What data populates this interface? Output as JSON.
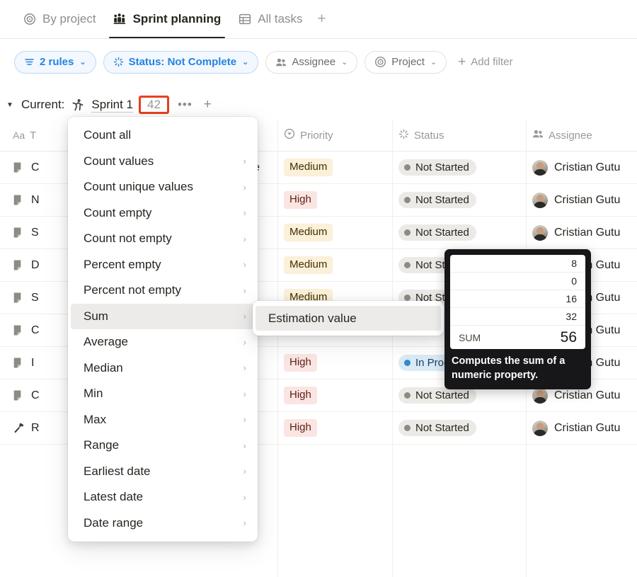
{
  "tabs": [
    {
      "label": "By project",
      "icon": "target-icon",
      "active": false
    },
    {
      "label": "Sprint planning",
      "icon": "people-board-icon",
      "active": true
    },
    {
      "label": "All tasks",
      "icon": "table-icon",
      "active": false
    }
  ],
  "tab_add_label": "+",
  "filters": {
    "rules": {
      "label": "2 rules",
      "icon": "rules-icon",
      "chevron": "⌄"
    },
    "status": {
      "label": "Status: Not Complete",
      "icon": "status-spinner-icon",
      "chevron": "⌄"
    },
    "assignee": {
      "label": "Assignee",
      "icon": "people-icon",
      "chevron": "⌄"
    },
    "project": {
      "label": "Project",
      "icon": "target-icon",
      "chevron": "⌄"
    },
    "add_filter": {
      "label": "Add filter",
      "plus": "+"
    }
  },
  "group": {
    "caret": "▼",
    "label": "Current:",
    "sprint_icon": "runner-icon",
    "sprint_name": "Sprint 1",
    "count": "42",
    "dots": "•••",
    "plus": "+"
  },
  "table": {
    "headers": [
      {
        "label": "T",
        "icon": "title-aa-icon"
      },
      {
        "label": "Priority",
        "icon": "priority-icon"
      },
      {
        "label": "Status",
        "icon": "status-spinner-icon"
      },
      {
        "label": "Assignee",
        "icon": "people-icon"
      }
    ],
    "rows": [
      {
        "icon": "document-icon",
        "title": "C",
        "title_tail": "e",
        "priority": "Medium",
        "status": "Not Started",
        "assignee": "Cristian Gutu"
      },
      {
        "icon": "document-icon",
        "title": "N",
        "title_tail": "",
        "priority": "High",
        "status": "Not Started",
        "assignee": "Cristian Gutu"
      },
      {
        "icon": "document-icon",
        "title": "S",
        "title_tail": "",
        "priority": "Medium",
        "status": "Not Started",
        "assignee": "Cristian Gutu"
      },
      {
        "icon": "document-icon",
        "title": "D",
        "title_tail": "",
        "priority": "Medium",
        "status": "Not Started",
        "assignee": "Cristian Gutu"
      },
      {
        "icon": "document-icon",
        "title": "S",
        "title_tail": "",
        "priority": "Medium",
        "status": "Not Started",
        "assignee": "Cristian Gutu"
      },
      {
        "icon": "document-icon",
        "title": "C",
        "title_tail": "",
        "priority": "",
        "status": "",
        "assignee": "Cristian Gutu"
      },
      {
        "icon": "document-icon",
        "title": "I",
        "title_tail": "",
        "priority": "High",
        "status": "In Progress",
        "assignee": "Cristian Gutu"
      },
      {
        "icon": "document-icon",
        "title": "C",
        "title_tail": "",
        "priority": "High",
        "status": "Not Started",
        "assignee": "Cristian Gutu"
      },
      {
        "icon": "hammer-icon",
        "title": "R",
        "title_tail": "",
        "priority": "High",
        "status": "Not Started",
        "assignee": "Cristian Gutu"
      }
    ]
  },
  "menu": {
    "items": [
      {
        "label": "Count all",
        "submenu": false,
        "highlighted": false
      },
      {
        "label": "Count values",
        "submenu": true,
        "highlighted": false
      },
      {
        "label": "Count unique values",
        "submenu": true,
        "highlighted": false
      },
      {
        "label": "Count empty",
        "submenu": true,
        "highlighted": false
      },
      {
        "label": "Count not empty",
        "submenu": true,
        "highlighted": false
      },
      {
        "label": "Percent empty",
        "submenu": true,
        "highlighted": false
      },
      {
        "label": "Percent not empty",
        "submenu": true,
        "highlighted": false
      },
      {
        "label": "Sum",
        "submenu": true,
        "highlighted": true
      },
      {
        "label": "Average",
        "submenu": true,
        "highlighted": false
      },
      {
        "label": "Median",
        "submenu": true,
        "highlighted": false
      },
      {
        "label": "Min",
        "submenu": true,
        "highlighted": false
      },
      {
        "label": "Max",
        "submenu": true,
        "highlighted": false
      },
      {
        "label": "Range",
        "submenu": true,
        "highlighted": false
      },
      {
        "label": "Earliest date",
        "submenu": true,
        "highlighted": false
      },
      {
        "label": "Latest date",
        "submenu": true,
        "highlighted": false
      },
      {
        "label": "Date range",
        "submenu": true,
        "highlighted": false
      }
    ],
    "arrow": "›"
  },
  "submenu": {
    "items": [
      {
        "label": "Estimation value",
        "highlighted": true
      }
    ]
  },
  "tooltip": {
    "values": [
      "8",
      "0",
      "16",
      "32"
    ],
    "sum_label": "SUM",
    "sum_value": "56",
    "description": "Computes the sum of a numeric property."
  },
  "colors": {
    "accent_blue": "#2383e2",
    "annotation_red": "#e8401f",
    "tag_medium_bg": "#fbf0d9",
    "tag_high_bg": "#fbe5e2",
    "status_inprogress_bg": "#d9ebf7"
  }
}
